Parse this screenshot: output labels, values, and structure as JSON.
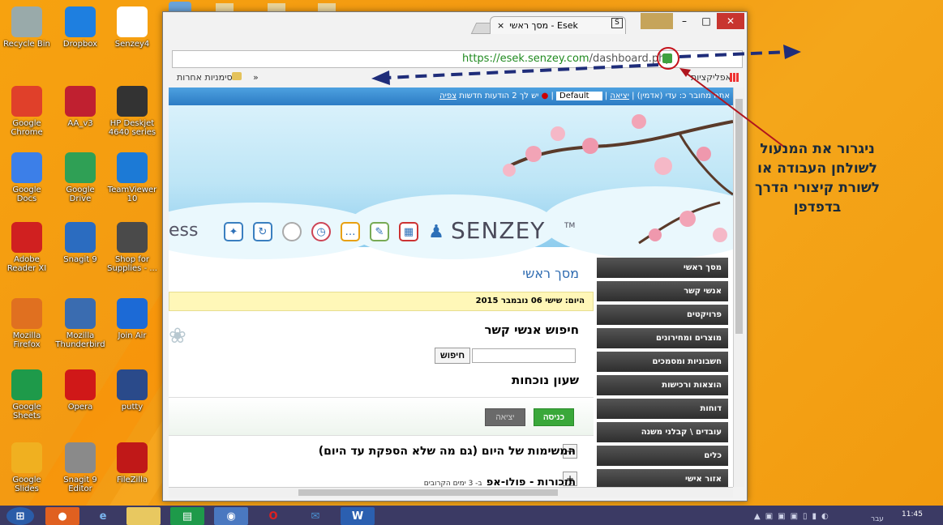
{
  "desktop": {
    "icons": [
      {
        "label": "Recycle Bin",
        "icon": "recycle-bin-icon"
      },
      {
        "label": "Dropbox",
        "icon": "dropbox-icon"
      },
      {
        "label": "Senzey4",
        "icon": "senzey-icon"
      },
      {
        "label": "Google Chrome",
        "icon": "chrome-icon"
      },
      {
        "label": "AA_v3",
        "icon": "aa-icon"
      },
      {
        "label": "HP Deskjet 4640 series",
        "icon": "printer-icon"
      },
      {
        "label": "Google Docs",
        "icon": "docs-icon"
      },
      {
        "label": "Google Drive",
        "icon": "drive-icon"
      },
      {
        "label": "TeamViewer 10",
        "icon": "teamviewer-icon"
      },
      {
        "label": "Adobe Reader XI",
        "icon": "adobe-icon"
      },
      {
        "label": "Snagit 9",
        "icon": "snagit-icon"
      },
      {
        "label": "Shop for Supplies - ...",
        "icon": "shop-icon"
      },
      {
        "label": "Mozilla Firefox",
        "icon": "firefox-icon"
      },
      {
        "label": "Mozilla Thunderbird",
        "icon": "thunderbird-icon"
      },
      {
        "label": "Join Air",
        "icon": "joinair-icon"
      },
      {
        "label": "Google Sheets",
        "icon": "sheets-icon"
      },
      {
        "label": "Opera",
        "icon": "opera-icon"
      },
      {
        "label": "putty",
        "icon": "putty-icon"
      },
      {
        "label": "Google Slides",
        "icon": "slides-icon"
      },
      {
        "label": "Snagit 9 Editor",
        "icon": "snagit-editor-icon"
      },
      {
        "label": "FileZilla",
        "icon": "filezilla-icon"
      }
    ]
  },
  "browser": {
    "tab_title": "מסך ראשי - Esek",
    "url_host": "https://esek.senzey.com",
    "url_path": "/dashboard.php",
    "bookmarks_apps": "אפליקציות",
    "bookmarks_other": "סימניות אחרות",
    "bookmarks_more": "»"
  },
  "page": {
    "topbar": {
      "connected_prefix": "אתה מחובר כ:",
      "user": "עדי (אדמין)",
      "logout": "יציאה",
      "theme": "Default",
      "messages": "יש לך 2 הודעות חדשות",
      "view": "צפיה"
    },
    "logo": "SENZEY",
    "logo_tm": "TM",
    "logo_left": "ess",
    "title": "מסך ראשי",
    "today": "היום: שישי 06 נובמבר 2015",
    "contact_search_title": "חיפוש אנשי קשר",
    "search_button": "חיפוש",
    "clock_title": "שעון נוכחות",
    "enter_button": "כניסה",
    "exit_button": "יציאה",
    "tasks_title": "המשימות של היום (גם מה שלא הספקת עד היום)",
    "reminders_title": "תזכורות - פולו-אפ",
    "reminders_sub": "ב- 3 ימים הקרובים",
    "nav": [
      "מסך ראשי",
      "אנשי קשר",
      "פרויקטים",
      "מוצרים ומחירונים",
      "חשבוניות ומסמכים",
      "הוצאות ורכישות",
      "דוחות",
      "עובדים \\ קבלני משנה",
      "כלים",
      "אזור אישי"
    ]
  },
  "annotation": "ניגרור את המנעול לשולחן העבודה או לשורת קיצורי הדרך בדפדפן",
  "taskbar": {
    "time": "11:45",
    "lang": "עבר"
  },
  "colors": {
    "desktop": "#f4a014",
    "accent_blue": "#2d7cc4",
    "nav_dark": "#3a3a3a",
    "enter_green": "#3aa83a",
    "arrow_navy": "#1f2d7a",
    "arrow_red": "#b0151e"
  }
}
